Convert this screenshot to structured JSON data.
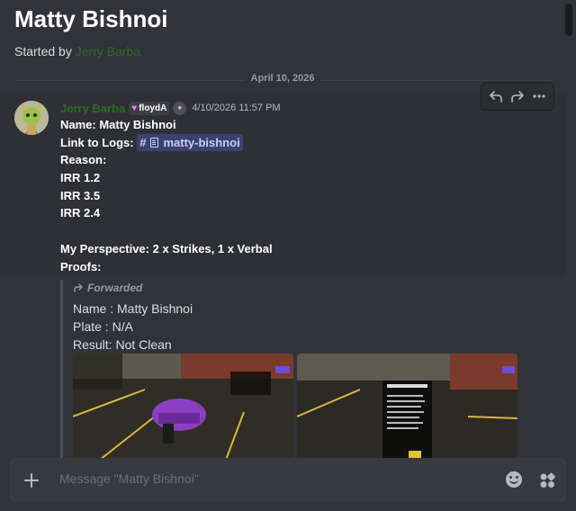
{
  "thread": {
    "title": "Matty Bishnoi",
    "started_by_prefix": "Started by ",
    "starter_name": "Jerry Barba"
  },
  "divider": {
    "date": "April 10, 2026"
  },
  "message": {
    "author": "Jerry Barba",
    "tag": "floydA",
    "timestamp": "4/10/2026 11:57 PM",
    "name_line": "Name: Matty Bishnoi",
    "link_label": "Link to Logs: ",
    "channel_mention": "matty-bishnoi",
    "reason_label": "Reason:",
    "reasons": [
      "IRR 1.2",
      "IRR 3.5",
      "IRR 2.4"
    ],
    "perspective": "My Perspective: 2 x Strikes, 1 x Verbal",
    "proofs_label": "Proofs:"
  },
  "forwarded": {
    "label": "Forwarded",
    "lines": [
      "Name : Matty Bishnoi",
      "Plate : N/A",
      "Result: Not Clean"
    ]
  },
  "composer": {
    "placeholder": "Message \"Matty Bishnoi\""
  },
  "colors": {
    "background": "#313338",
    "author_green": "#2d6a26",
    "mention_bg": "#3c4270",
    "composer_bg": "#383a40"
  },
  "icons": {
    "reply": "reply-arrow-icon",
    "forward": "forward-arrow-icon",
    "more": "more-dots-icon",
    "plus": "plus-icon",
    "emoji": "emoji-icon",
    "apps": "apps-icon"
  }
}
